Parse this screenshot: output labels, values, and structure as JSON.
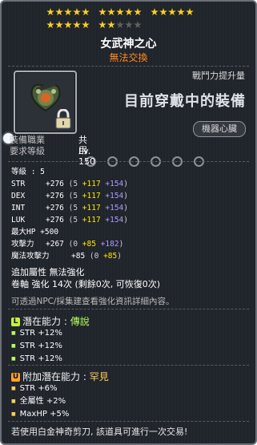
{
  "item": {
    "name": "女武神之心",
    "trade": "無法交換",
    "combat_label": "戰鬥力提升量",
    "equipped_label": "目前穿戴中的裝備",
    "machine_label": "機器心臟"
  },
  "stars": [
    1,
    1,
    1,
    1,
    1,
    1,
    1,
    1,
    1,
    1,
    1,
    1,
    1,
    1,
    1,
    1,
    1,
    1,
    1,
    1,
    1,
    1,
    0,
    0,
    0
  ],
  "requirements": {
    "job_label": "裝備職業",
    "job_value": "共用",
    "level_label": "要求等級",
    "level_value": "Lv. 150"
  },
  "stats": {
    "level": "等級 : 5",
    "rows": [
      {
        "label": "STR",
        "base": "+276",
        "open": " (5 ",
        "add": "+117",
        "plus": " +154",
        "close": ")"
      },
      {
        "label": "DEX",
        "base": "+276",
        "open": " (5 ",
        "add": "+117",
        "plus": " +154",
        "close": ")"
      },
      {
        "label": "INT",
        "base": "+276",
        "open": " (5 ",
        "add": "+117",
        "plus": " +154",
        "close": ")"
      },
      {
        "label": "LUK",
        "base": "+276",
        "open": " (5 ",
        "add": "+117",
        "plus": " +154",
        "close": ")"
      }
    ],
    "maxhp": "最大HP  +500",
    "attack": {
      "label": "攻擊力",
      "base": "+267",
      "open": " (0 ",
      "add": "+85",
      "plus": " +182",
      "close": ")"
    },
    "magic": {
      "label": "魔法攻擊力",
      "base": "+85",
      "open": " (0 ",
      "add": "+85",
      "close": ")"
    }
  },
  "extra": {
    "added_property": "追加屬性  無法強化",
    "enhance": "卷軸 強化 14次 (剩餘0次, 可恢復0次)"
  },
  "note": "可透過NPC/採集建查看強化資訊詳細內容。",
  "potential": {
    "label": "潛在能力 : ",
    "grade": "傳說",
    "lines": [
      "STR +12%",
      "STR +12%",
      "STR +12%"
    ]
  },
  "additional": {
    "label": "附加潛在能力 : ",
    "grade": "罕見",
    "lines": [
      "STR +6%",
      "全屬性 +2%",
      "MaxHP +5%"
    ]
  },
  "footer": "若使用白金神奇剪刀, 該道具可進行一次交易!"
}
